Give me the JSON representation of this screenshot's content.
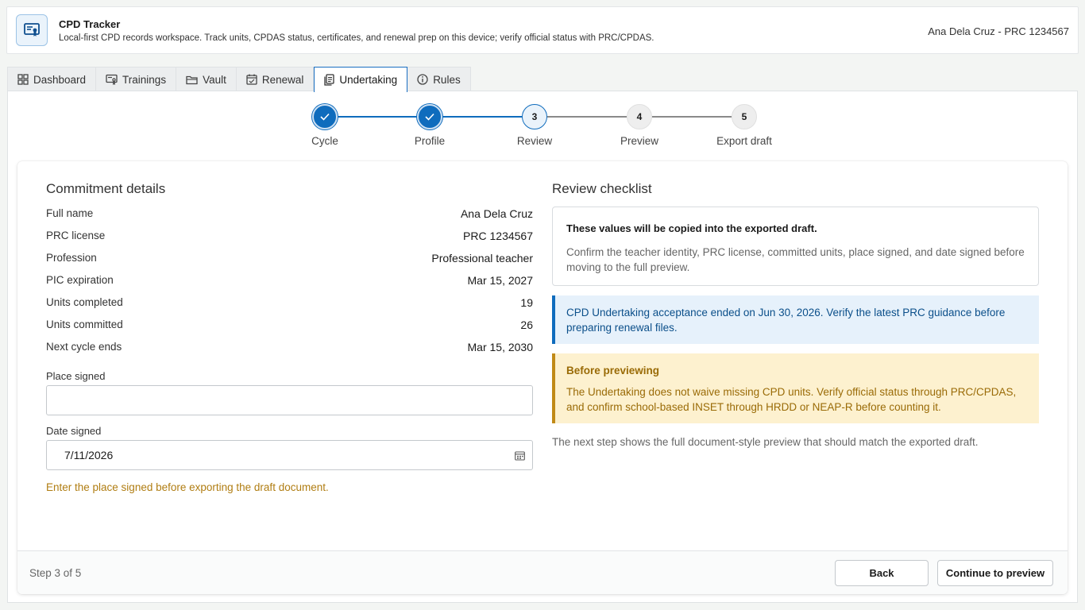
{
  "header": {
    "title": "CPD Tracker",
    "subtitle": "Local-first CPD records workspace. Track units, CPDAS status, certificates, and renewal prep on this device; verify official status with PRC/CPDAS.",
    "user": "Ana Dela Cruz - PRC 1234567"
  },
  "tabs": [
    {
      "label": "Dashboard",
      "icon": "grid-icon"
    },
    {
      "label": "Trainings",
      "icon": "certificate-icon"
    },
    {
      "label": "Vault",
      "icon": "folder-icon"
    },
    {
      "label": "Renewal",
      "icon": "calendar-icon"
    },
    {
      "label": "Undertaking",
      "icon": "document-icon",
      "active": true
    },
    {
      "label": "Rules",
      "icon": "info-icon"
    }
  ],
  "stepper": {
    "steps": [
      {
        "number": "1",
        "label": "Cycle",
        "state": "done"
      },
      {
        "number": "2",
        "label": "Profile",
        "state": "done"
      },
      {
        "number": "3",
        "label": "Review",
        "state": "current"
      },
      {
        "number": "4",
        "label": "Preview",
        "state": "todo"
      },
      {
        "number": "5",
        "label": "Export draft",
        "state": "todo"
      }
    ]
  },
  "commitment": {
    "title": "Commitment details",
    "rows": [
      {
        "label": "Full name",
        "value": "Ana Dela Cruz"
      },
      {
        "label": "PRC license",
        "value": "PRC 1234567"
      },
      {
        "label": "Profession",
        "value": "Professional teacher"
      },
      {
        "label": "PIC expiration",
        "value": "Mar 15, 2027"
      },
      {
        "label": "Units completed",
        "value": "19"
      },
      {
        "label": "Units committed",
        "value": "26"
      },
      {
        "label": "Next cycle ends",
        "value": "Mar 15, 2030"
      }
    ],
    "place_signed_label": "Place signed",
    "place_signed_value": "",
    "date_signed_label": "Date signed",
    "date_signed_value": "7/11/2026",
    "warning": "Enter the place signed before exporting the draft document."
  },
  "checklist": {
    "title": "Review checklist",
    "info_title": "These values will be copied into the exported draft.",
    "info_text": "Confirm the teacher identity, PRC license, committed units, place signed, and date signed before moving to the full preview.",
    "notice_blue": "CPD Undertaking acceptance ended on Jun 30, 2026. Verify the latest PRC guidance before preparing renewal files.",
    "notice_amber_title": "Before previewing",
    "notice_amber_text": "The Undertaking does not waive missing CPD units. Verify official status through PRC/CPDAS, and confirm school-based INSET through HRDD or NEAP-R before counting it.",
    "next_note": "The next step shows the full document-style preview that should match the exported draft."
  },
  "footer": {
    "step_count": "Step 3 of 5",
    "back_label": "Back",
    "continue_label": "Continue to preview"
  },
  "colors": {
    "accent": "#0f6cbd",
    "warning": "#b07d12",
    "notice_blue_bg": "#e6f1fb",
    "notice_amber_bg": "#fdf1cf"
  }
}
